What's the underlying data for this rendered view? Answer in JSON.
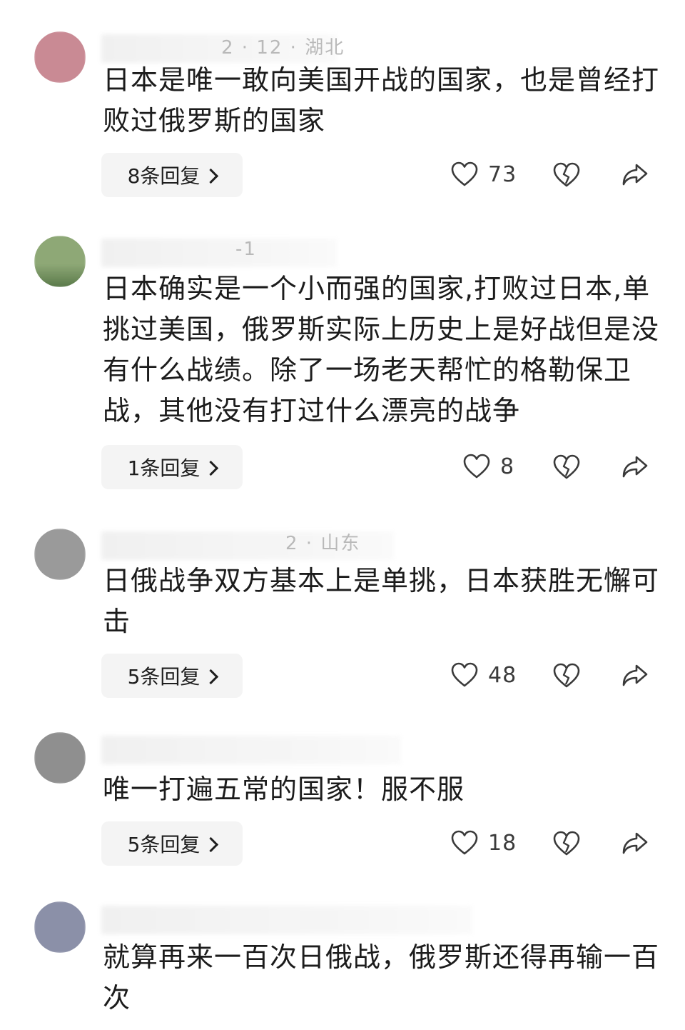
{
  "comments": [
    {
      "avatar_color": "#c98a94",
      "meta_text": "2 · 12 · 湖北",
      "text": "日本是唯一敢向美国开战的国家，也是曾经打败过俄罗斯的国家",
      "reply_label": "8条回复",
      "likes": "73"
    },
    {
      "avatar_color": "#8ea876",
      "meta_text": "-1",
      "text": "日本确实是一个小而强的国家,打败过日本,单挑过美国，俄罗斯实际上历史上是好战但是没有什么战绩。除了一场老天帮忙的格勒保卫战，其他没有打过什么漂亮的战争",
      "reply_label": "1条回复",
      "likes": "8"
    },
    {
      "avatar_color": "#9a9a9a",
      "meta_text": "2 · 山东",
      "text": "日俄战争双方基本上是单挑，日本获胜无懈可击",
      "reply_label": "5条回复",
      "likes": "48"
    },
    {
      "avatar_color": "#8f8f8f",
      "meta_text": "",
      "text": "唯一打遍五常的国家！服不服",
      "reply_label": "5条回复",
      "likes": "18"
    },
    {
      "avatar_color": "#8b90a8",
      "meta_text": "",
      "text": "就算再来一百次日俄战，俄罗斯还得再输一百次",
      "reply_label": "",
      "likes": ""
    }
  ],
  "icons": {
    "like": "heart-outline-icon",
    "dislike": "broken-heart-icon",
    "share": "share-arrow-icon",
    "chevron": "chevron-right-icon"
  },
  "colors": {
    "text": "#1c1c1c",
    "pill": "#f4f4f4",
    "icon": "#3a3a3a"
  }
}
